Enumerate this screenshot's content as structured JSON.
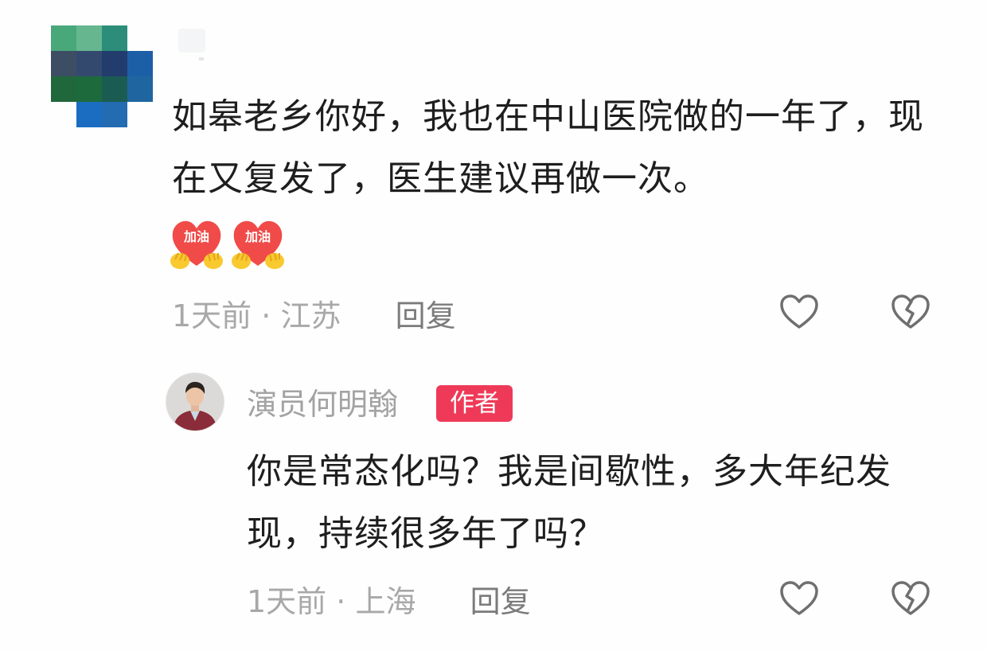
{
  "comment": {
    "text": "如皋老乡你好，我也在中山医院做的一年了，现在又复发了，医生建议再做一次。",
    "emojis": [
      {
        "label": "加油",
        "icon": "cheer-heart-emoji"
      },
      {
        "label": "加油",
        "icon": "cheer-heart-emoji"
      }
    ],
    "time": "1天前",
    "location": "江苏",
    "reply_label": "回复",
    "like_icon": "heart-outline-icon",
    "dislike_icon": "broken-heart-icon"
  },
  "reply": {
    "author_name": "演员何明翰",
    "author_badge": "作者",
    "text": "你是常态化吗？我是间歇性，多大年纪发现，持续很多年了吗？",
    "time": "1天前",
    "location": "上海",
    "reply_label": "回复",
    "like_icon": "heart-outline-icon",
    "dislike_icon": "broken-heart-icon"
  },
  "colors": {
    "text_primary": "#1e1e1e",
    "meta_text": "#a8a8a8",
    "badge_bg": "#ee3a58",
    "icon_stroke": "#6f6f6f"
  }
}
